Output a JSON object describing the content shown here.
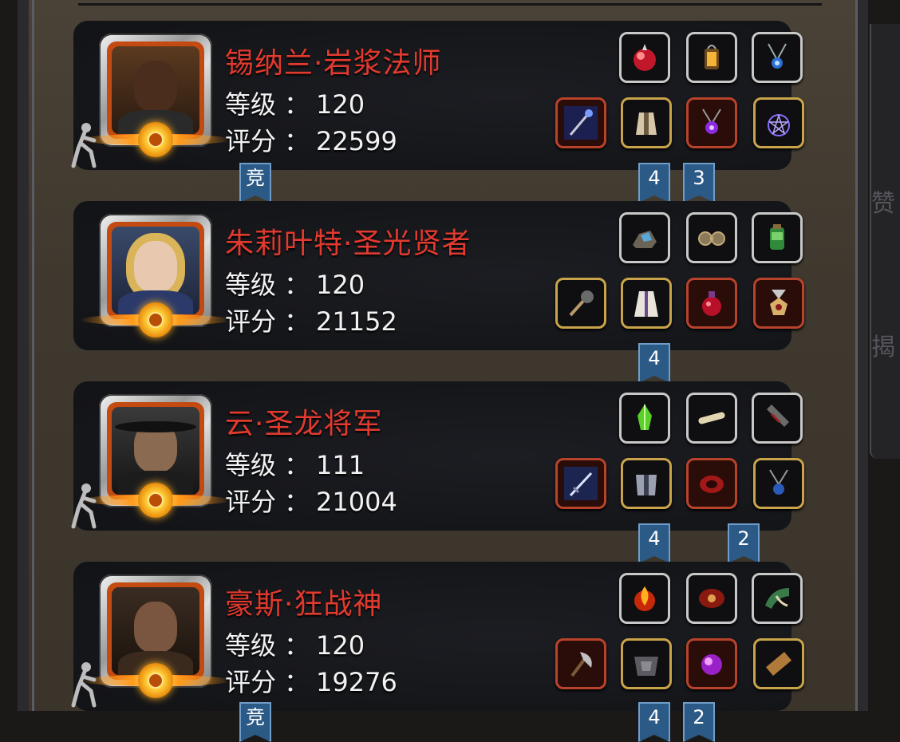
{
  "labels": {
    "level": "等级",
    "score": "评分",
    "colon": "："
  },
  "side_tabs": [
    "赞",
    "揭"
  ],
  "colors": {
    "name_red": "#e23a2e",
    "ribbon_blue": "#2c5a86",
    "frame_gold": "#c9a44a",
    "frame_red": "#b8432b",
    "frame_silver": "#b9b9b9"
  },
  "heroes": [
    {
      "name": "锡纳兰·岩浆法师",
      "level": "120",
      "score": "22599",
      "equipment_top": [
        "red-orb-icon",
        "lantern-icon",
        "blue-amulet-icon"
      ],
      "equipment_bottom": [
        "staff-icon",
        "robe-armor-icon",
        "purple-amulet-icon",
        "pentagram-amulet-icon"
      ],
      "ribbons": [
        "竞",
        "4",
        "3"
      ]
    },
    {
      "name": "朱莉叶特·圣光贤者",
      "level": "120",
      "score": "21152",
      "equipment_top": [
        "rock-crystal-icon",
        "goggles-icon",
        "green-flask-icon"
      ],
      "equipment_bottom": [
        "mace-icon",
        "white-robe-icon",
        "red-potion-icon",
        "medal-icon"
      ],
      "ribbons": [
        "4"
      ]
    },
    {
      "name": "云·圣龙将军",
      "level": "111",
      "score": "21004",
      "equipment_top": [
        "green-crystal-icon",
        "bone-flute-icon",
        "bracer-icon"
      ],
      "equipment_bottom": [
        "sword-icon",
        "plate-armor-icon",
        "red-ring-icon",
        "blue-pendant-icon"
      ],
      "ribbons": [
        "4",
        "2"
      ]
    },
    {
      "name": "豪斯·狂战神",
      "level": "120",
      "score": "19276",
      "equipment_top": [
        "fire-orb-icon",
        "red-scroll-icon",
        "green-horn-icon"
      ],
      "equipment_bottom": [
        "axe-icon",
        "chest-plate-icon",
        "purple-gem-icon",
        "wooden-plank-icon"
      ],
      "ribbons": [
        "竞",
        "4",
        "2"
      ]
    }
  ]
}
